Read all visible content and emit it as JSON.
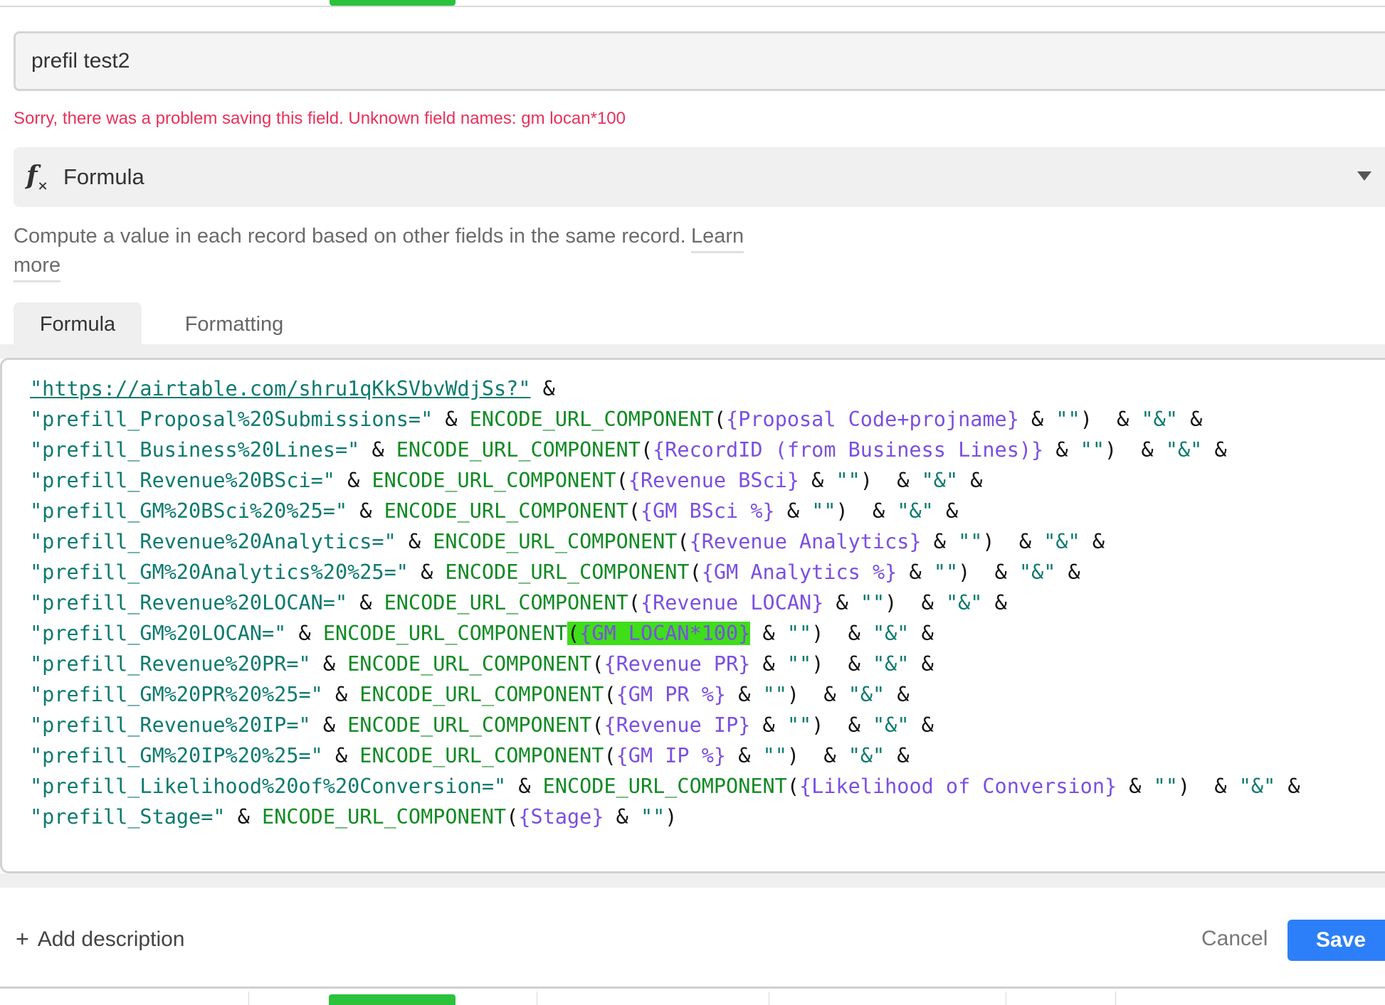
{
  "field": {
    "name_value": "prefil test2",
    "error": "Sorry, there was a problem saving this field. Unknown field names: gm locan*100",
    "type_icon": "fx-formula-icon",
    "type_label": "Formula",
    "description": "Compute a value in each record based on other fields in the same record.",
    "learn_more_1": "Learn",
    "learn_more_2": "more"
  },
  "tabs": [
    {
      "label": "Formula",
      "active": true
    },
    {
      "label": "Formatting",
      "active": false
    }
  ],
  "formula_lines": [
    [
      [
        "str url",
        "\"https://airtable.com/shru1qKkSVbvWdjSs?\""
      ],
      [
        "op",
        " &"
      ]
    ],
    [
      [
        "str",
        "\"prefill_Proposal%20Submissions=\""
      ],
      [
        "op",
        " & "
      ],
      [
        "fn",
        "ENCODE_URL_COMPONENT"
      ],
      [
        "op",
        "("
      ],
      [
        "fld",
        "{Proposal Code+projname}"
      ],
      [
        "op",
        " & "
      ],
      [
        "str",
        "\"\""
      ],
      [
        "op",
        ")  & "
      ],
      [
        "str",
        "\"&\""
      ],
      [
        "op",
        " &"
      ]
    ],
    [
      [
        "str",
        "\"prefill_Business%20Lines=\""
      ],
      [
        "op",
        " & "
      ],
      [
        "fn",
        "ENCODE_URL_COMPONENT"
      ],
      [
        "op",
        "("
      ],
      [
        "fld",
        "{RecordID (from Business Lines)}"
      ],
      [
        "op",
        " & "
      ],
      [
        "str",
        "\"\""
      ],
      [
        "op",
        ")  & "
      ],
      [
        "str",
        "\"&\""
      ],
      [
        "op",
        " &"
      ]
    ],
    [
      [
        "str",
        "\"prefill_Revenue%20BSci=\""
      ],
      [
        "op",
        " & "
      ],
      [
        "fn",
        "ENCODE_URL_COMPONENT"
      ],
      [
        "op",
        "("
      ],
      [
        "fld",
        "{Revenue BSci}"
      ],
      [
        "op",
        " & "
      ],
      [
        "str",
        "\"\""
      ],
      [
        "op",
        ")  & "
      ],
      [
        "str",
        "\"&\""
      ],
      [
        "op",
        " &"
      ]
    ],
    [
      [
        "str",
        "\"prefill_GM%20BSci%20%25=\""
      ],
      [
        "op",
        " & "
      ],
      [
        "fn",
        "ENCODE_URL_COMPONENT"
      ],
      [
        "op",
        "("
      ],
      [
        "fld",
        "{GM BSci %}"
      ],
      [
        "op",
        " & "
      ],
      [
        "str",
        "\"\""
      ],
      [
        "op",
        ")  & "
      ],
      [
        "str",
        "\"&\""
      ],
      [
        "op",
        " &"
      ]
    ],
    [
      [
        "str",
        "\"prefill_Revenue%20Analytics=\""
      ],
      [
        "op",
        " & "
      ],
      [
        "fn",
        "ENCODE_URL_COMPONENT"
      ],
      [
        "op",
        "("
      ],
      [
        "fld",
        "{Revenue Analytics}"
      ],
      [
        "op",
        " & "
      ],
      [
        "str",
        "\"\""
      ],
      [
        "op",
        ")  & "
      ],
      [
        "str",
        "\"&\""
      ],
      [
        "op",
        " &"
      ]
    ],
    [
      [
        "str",
        "\"prefill_GM%20Analytics%20%25=\""
      ],
      [
        "op",
        " & "
      ],
      [
        "fn",
        "ENCODE_URL_COMPONENT"
      ],
      [
        "op",
        "("
      ],
      [
        "fld",
        "{GM Analytics %}"
      ],
      [
        "op",
        " & "
      ],
      [
        "str",
        "\"\""
      ],
      [
        "op",
        ")  & "
      ],
      [
        "str",
        "\"&\""
      ],
      [
        "op",
        " &"
      ]
    ],
    [
      [
        "str",
        "\"prefill_Revenue%20LOCAN=\""
      ],
      [
        "op",
        " & "
      ],
      [
        "fn",
        "ENCODE_URL_COMPONENT"
      ],
      [
        "op",
        "("
      ],
      [
        "fld",
        "{Revenue LOCAN}"
      ],
      [
        "op",
        " & "
      ],
      [
        "str",
        "\"\""
      ],
      [
        "op",
        ")  & "
      ],
      [
        "str",
        "\"&\""
      ],
      [
        "op",
        " &"
      ]
    ],
    [
      [
        "str",
        "\"prefill_GM%20LOCAN=\""
      ],
      [
        "op",
        " & "
      ],
      [
        "fn",
        "ENCODE_URL_COMPONENT"
      ],
      [
        "op hl",
        "("
      ],
      [
        "fld hl",
        "{GM LOCAN*100}"
      ],
      [
        "op",
        " & "
      ],
      [
        "str",
        "\"\""
      ],
      [
        "op",
        ")  & "
      ],
      [
        "str",
        "\"&\""
      ],
      [
        "op",
        " &"
      ]
    ],
    [
      [
        "str",
        "\"prefill_Revenue%20PR=\""
      ],
      [
        "op",
        " & "
      ],
      [
        "fn",
        "ENCODE_URL_COMPONENT"
      ],
      [
        "op",
        "("
      ],
      [
        "fld",
        "{Revenue PR}"
      ],
      [
        "op",
        " & "
      ],
      [
        "str",
        "\"\""
      ],
      [
        "op",
        ")  & "
      ],
      [
        "str",
        "\"&\""
      ],
      [
        "op",
        " &"
      ]
    ],
    [
      [
        "str",
        "\"prefill_GM%20PR%20%25=\""
      ],
      [
        "op",
        " & "
      ],
      [
        "fn",
        "ENCODE_URL_COMPONENT"
      ],
      [
        "op",
        "("
      ],
      [
        "fld",
        "{GM PR %}"
      ],
      [
        "op",
        " & "
      ],
      [
        "str",
        "\"\""
      ],
      [
        "op",
        ")  & "
      ],
      [
        "str",
        "\"&\""
      ],
      [
        "op",
        " &"
      ]
    ],
    [
      [
        "str",
        "\"prefill_Revenue%20IP=\""
      ],
      [
        "op",
        " & "
      ],
      [
        "fn",
        "ENCODE_URL_COMPONENT"
      ],
      [
        "op",
        "("
      ],
      [
        "fld",
        "{Revenue IP}"
      ],
      [
        "op",
        " & "
      ],
      [
        "str",
        "\"\""
      ],
      [
        "op",
        ")  & "
      ],
      [
        "str",
        "\"&\""
      ],
      [
        "op",
        " &"
      ]
    ],
    [
      [
        "str",
        "\"prefill_GM%20IP%20%25=\""
      ],
      [
        "op",
        " & "
      ],
      [
        "fn",
        "ENCODE_URL_COMPONENT"
      ],
      [
        "op",
        "("
      ],
      [
        "fld",
        "{GM IP %}"
      ],
      [
        "op",
        " & "
      ],
      [
        "str",
        "\"\""
      ],
      [
        "op",
        ")  & "
      ],
      [
        "str",
        "\"&\""
      ],
      [
        "op",
        " &"
      ]
    ],
    [
      [
        "str",
        "\"prefill_Likelihood%20of%20Conversion=\""
      ],
      [
        "op",
        " & "
      ],
      [
        "fn",
        "ENCODE_URL_COMPONENT"
      ],
      [
        "op",
        "("
      ],
      [
        "fld",
        "{Likelihood of Conversion}"
      ],
      [
        "op",
        " & "
      ],
      [
        "str",
        "\"\""
      ],
      [
        "op",
        ")  & "
      ],
      [
        "str",
        "\"&\""
      ],
      [
        "op",
        " &"
      ]
    ],
    [
      [
        "str",
        "\"prefill_Stage=\""
      ],
      [
        "op",
        " & "
      ],
      [
        "fn",
        "ENCODE_URL_COMPONENT"
      ],
      [
        "op",
        "("
      ],
      [
        "fld",
        "{Stage}"
      ],
      [
        "op",
        " & "
      ],
      [
        "str",
        "\"\""
      ],
      [
        "op",
        ")"
      ]
    ]
  ],
  "footer": {
    "add_description_icon": "plus-icon",
    "add_description": "Add description",
    "cancel": "Cancel",
    "save": "Save"
  },
  "colors": {
    "error": "#e8315b",
    "save_button": "#2d7ff9",
    "highlight": "#3fdd1a",
    "string": "#0d7a6e",
    "function": "#118a23",
    "field_ref": "#7b4fe0"
  }
}
